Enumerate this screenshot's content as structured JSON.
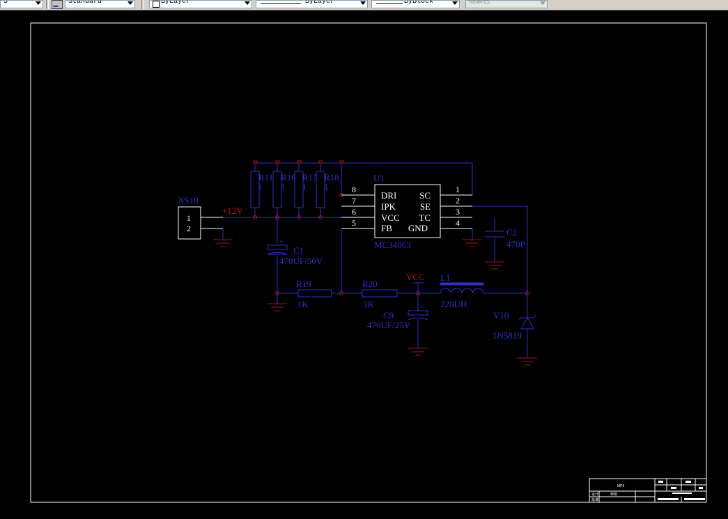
{
  "toolbar": {
    "text_style_value": "Standard",
    "color_value": "ByLayer",
    "linetype_value": "ByLayer",
    "lineweight_value": "ByBlock",
    "plotstyle_value": "随颜色",
    "partial_left": "5"
  },
  "schematic": {
    "connector": {
      "ref": "XS10",
      "pin1": "1",
      "pin2": "2"
    },
    "net_12v": "+12V",
    "net_vcc": "VCC",
    "resistors": [
      {
        "ref": "R11",
        "value": "1"
      },
      {
        "ref": "R16",
        "value": "1"
      },
      {
        "ref": "R17",
        "value": "1"
      },
      {
        "ref": "R18",
        "value": "1"
      }
    ],
    "ic": {
      "ref": "U1",
      "part": "MC34063",
      "left_pins": [
        "8",
        "7",
        "6",
        "5"
      ],
      "left_labels": [
        "DRI",
        "IPK",
        "VCC",
        "FB"
      ],
      "right_pins": [
        "1",
        "2",
        "3",
        "4"
      ],
      "right_labels": [
        "SC",
        "SE",
        "TC",
        "GND"
      ]
    },
    "c1": {
      "ref": "C1",
      "value": "470UF/50V"
    },
    "c2": {
      "ref": "C2",
      "value": "470P"
    },
    "c9": {
      "ref": "C9",
      "value": "470UF/25V"
    },
    "r19": {
      "ref": "R19",
      "value": "1K"
    },
    "r20": {
      "ref": "R20",
      "value": "3K"
    },
    "l1": {
      "ref": "L1",
      "value": "220UH"
    },
    "v10": {
      "ref": "V10",
      "value": "1N5819"
    }
  },
  "title_block": {
    "name_cell": "MP6",
    "row2_label": "设计",
    "row2_value": "审核",
    "row3_label": "批准"
  },
  "colors": {
    "wire": "#3030c8",
    "net_label": "#b01818",
    "ground": "#9a1a1a",
    "pin_white": "#ffffff",
    "border": "#ffffff",
    "background": "#000000"
  }
}
